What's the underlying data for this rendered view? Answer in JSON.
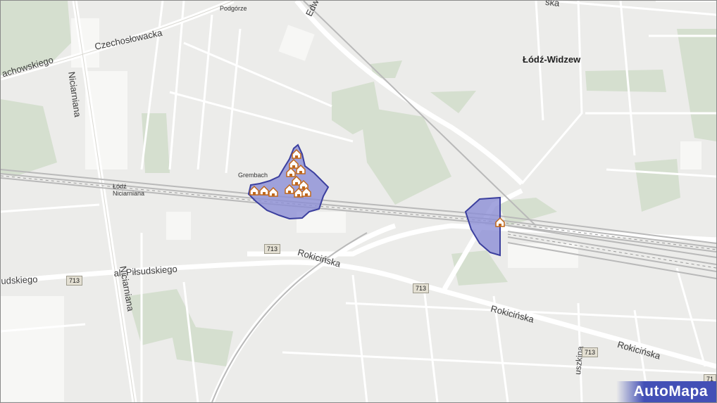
{
  "map": {
    "districts": [
      {
        "name": "Łódź-Widzew"
      }
    ],
    "places": [
      {
        "name": "Podgórze"
      },
      {
        "name": "Grembach"
      },
      {
        "name": "Łódź Niciarniana"
      }
    ],
    "streets": [
      {
        "name": "Czechosłowacka"
      },
      {
        "name": "achowskiego"
      },
      {
        "name": "Niciarniana"
      },
      {
        "name": "Niciarniana"
      },
      {
        "name": "al. Piłsudskiego"
      },
      {
        "name": "udskiego"
      },
      {
        "name": "Rokicińska"
      },
      {
        "name": "Rokicińska"
      },
      {
        "name": "Rokicińska"
      },
      {
        "name": "Edw"
      },
      {
        "name": "ska"
      },
      {
        "name": "uszkina"
      }
    ],
    "road_shields": [
      "713",
      "713",
      "713",
      "713",
      "71"
    ],
    "highlight_color": "#8c8fd6",
    "highlight_stroke": "#3b3f9e",
    "marker_icon": "house-icon"
  },
  "branding": {
    "logo_text": "AutoMapa"
  }
}
